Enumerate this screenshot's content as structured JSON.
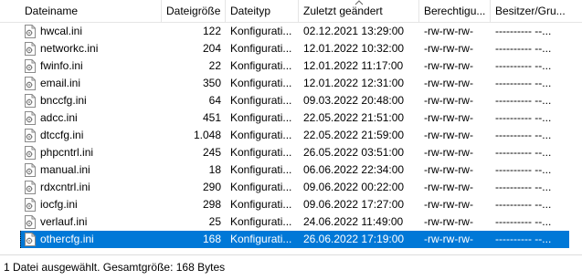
{
  "columns": {
    "name": "Dateiname",
    "size": "Dateigröße",
    "type": "Dateityp",
    "modified": "Zuletzt geändert",
    "permissions": "Berechtigu...",
    "owner": "Besitzer/Gru..."
  },
  "files": [
    {
      "name": "hwcal.ini",
      "size": "122",
      "type": "Konfigurati...",
      "modified": "02.12.2021 13:29:00",
      "permissions": "-rw-rw-rw-",
      "owner": "---------- --..."
    },
    {
      "name": "networkc.ini",
      "size": "204",
      "type": "Konfigurati...",
      "modified": "12.01.2022 10:32:00",
      "permissions": "-rw-rw-rw-",
      "owner": "---------- --..."
    },
    {
      "name": "fwinfo.ini",
      "size": "22",
      "type": "Konfigurati...",
      "modified": "12.01.2022 11:17:00",
      "permissions": "-rw-rw-rw-",
      "owner": "---------- --..."
    },
    {
      "name": "email.ini",
      "size": "350",
      "type": "Konfigurati...",
      "modified": "12.01.2022 12:31:00",
      "permissions": "-rw-rw-rw-",
      "owner": "---------- --..."
    },
    {
      "name": "bnccfg.ini",
      "size": "64",
      "type": "Konfigurati...",
      "modified": "09.03.2022 20:48:00",
      "permissions": "-rw-rw-rw-",
      "owner": "---------- --..."
    },
    {
      "name": "adcc.ini",
      "size": "451",
      "type": "Konfigurati...",
      "modified": "22.05.2022 21:51:00",
      "permissions": "-rw-rw-rw-",
      "owner": "---------- --..."
    },
    {
      "name": "dtccfg.ini",
      "size": "1.048",
      "type": "Konfigurati...",
      "modified": "22.05.2022 21:59:00",
      "permissions": "-rw-rw-rw-",
      "owner": "---------- --..."
    },
    {
      "name": "phpcntrl.ini",
      "size": "245",
      "type": "Konfigurati...",
      "modified": "26.05.2022 03:51:00",
      "permissions": "-rw-rw-rw-",
      "owner": "---------- --..."
    },
    {
      "name": "manual.ini",
      "size": "18",
      "type": "Konfigurati...",
      "modified": "06.06.2022 22:34:00",
      "permissions": "-rw-rw-rw-",
      "owner": "---------- --..."
    },
    {
      "name": "rdxcntrl.ini",
      "size": "290",
      "type": "Konfigurati...",
      "modified": "09.06.2022 00:22:00",
      "permissions": "-rw-rw-rw-",
      "owner": "---------- --..."
    },
    {
      "name": "iocfg.ini",
      "size": "298",
      "type": "Konfigurati...",
      "modified": "09.06.2022 17:27:00",
      "permissions": "-rw-rw-rw-",
      "owner": "---------- --..."
    },
    {
      "name": "verlauf.ini",
      "size": "25",
      "type": "Konfigurati...",
      "modified": "24.06.2022 11:49:00",
      "permissions": "-rw-rw-rw-",
      "owner": "---------- --..."
    },
    {
      "name": "othercfg.ini",
      "size": "168",
      "type": "Konfigurati...",
      "modified": "26.06.2022 17:19:00",
      "permissions": "-rw-rw-rw-",
      "owner": "---------- --...",
      "selected": true
    }
  ],
  "status": "1 Datei ausgewählt. Gesamtgröße: 168 Bytes",
  "sort": {
    "column": "modified",
    "direction": "ascending",
    "icon": "sort-up-icon"
  },
  "file_icon": "ini-file-icon",
  "colors": {
    "selection": "#0078d7",
    "grid": "#e5e5e5"
  }
}
